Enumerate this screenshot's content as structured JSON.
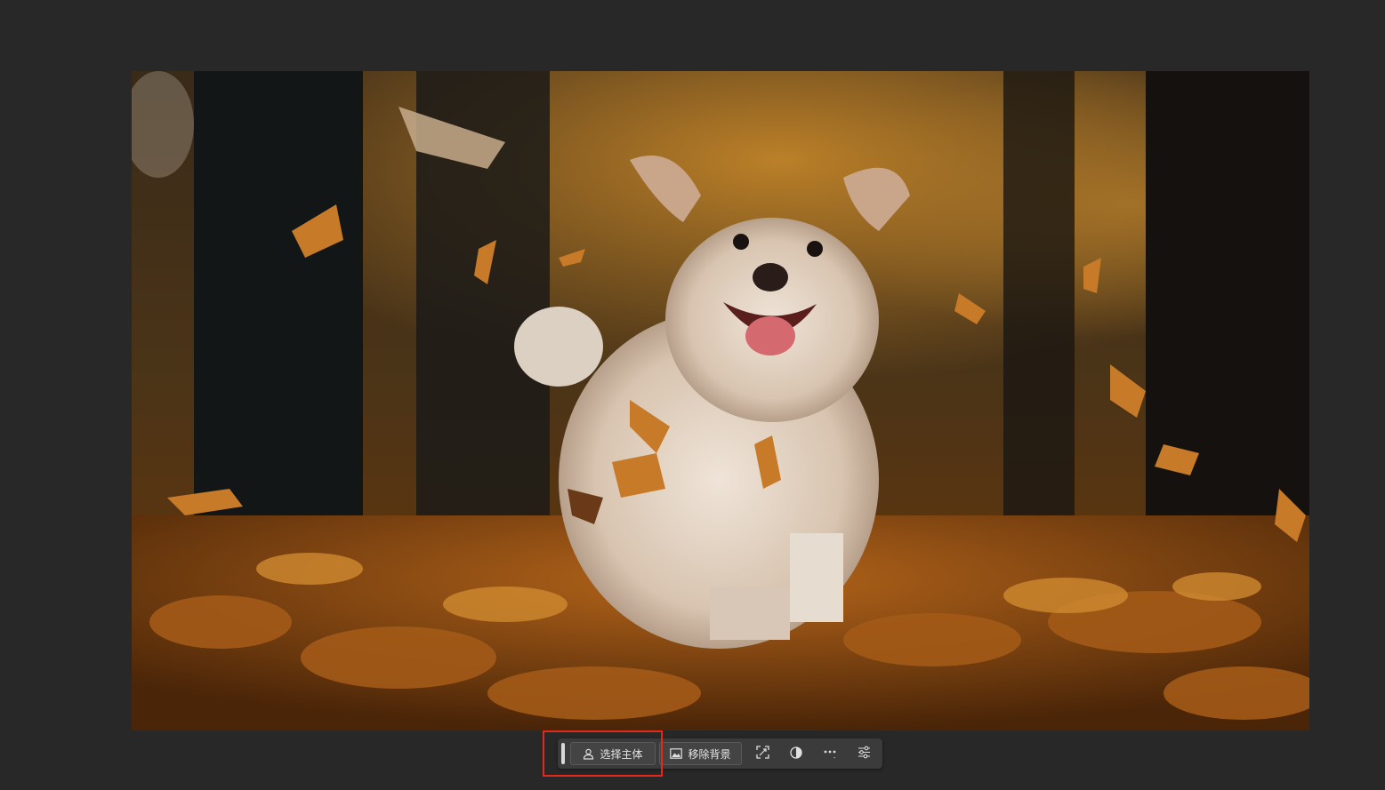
{
  "canvas": {
    "background": "#282828",
    "image_description_icon": "photo-dog-autumn-leaves"
  },
  "context_taskbar": {
    "select_subject_label": "选择主体",
    "remove_background_label": "移除背景",
    "icons": {
      "select_subject": "person-icon",
      "remove_background": "image-icon",
      "transform": "crop-expand-icon",
      "adjust": "contrast-icon",
      "more": "ellipsis-icon",
      "settings": "sliders-icon"
    }
  },
  "highlight": {
    "color": "#e5281c",
    "target": "select-subject-button"
  }
}
